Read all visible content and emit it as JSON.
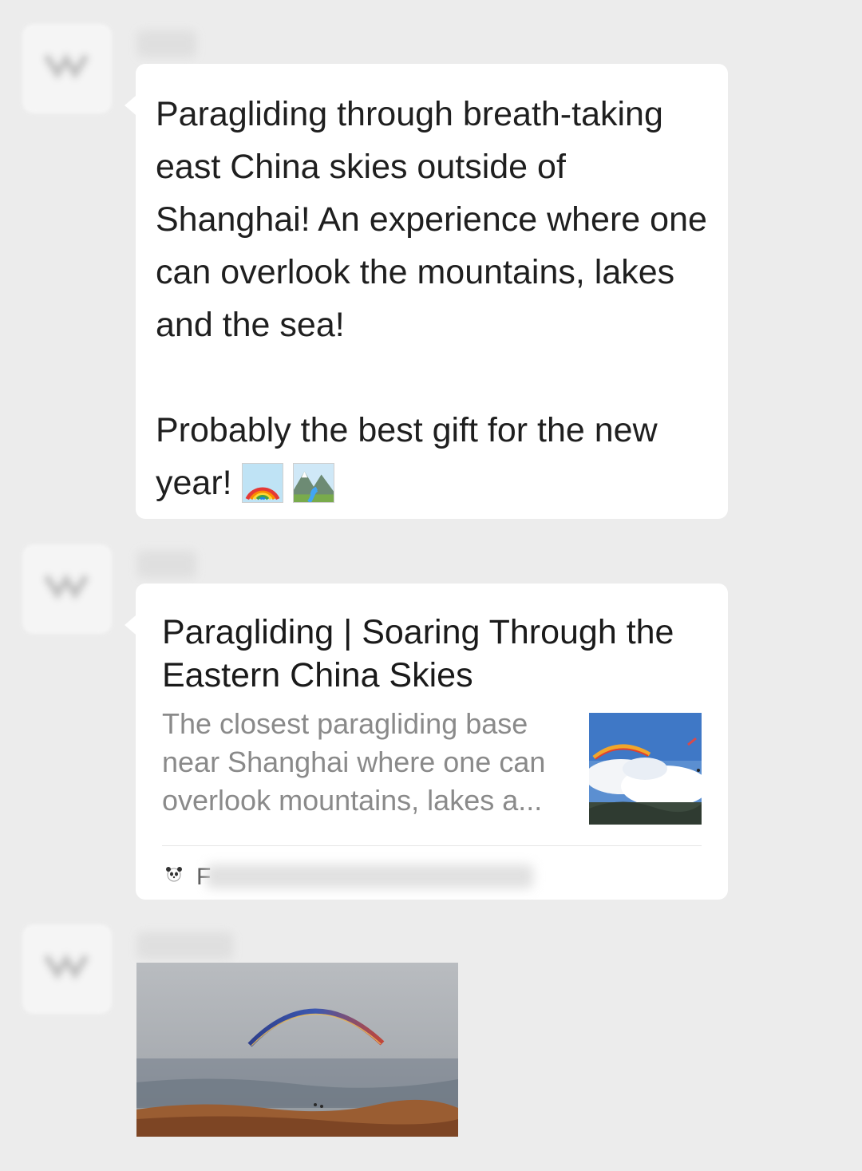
{
  "messages": [
    {
      "type": "text",
      "text": "Paragliding through breath-taking east China skies outside of Shanghai! An experience where one can overlook the mountains, lakes and the sea!\n\nProbably the best gift for the new year!",
      "emojis": [
        "rainbow-icon",
        "national-park-icon"
      ]
    },
    {
      "type": "link",
      "title": "Paragliding | Soaring Through the Eastern China Skies",
      "description": "The closest paragliding base near Shanghai where one can overlook mountains, lakes a...",
      "thumbnail": "paraglider-over-clouds-image",
      "source_visible_text": "F",
      "source_icon": "panda-icon"
    },
    {
      "type": "image",
      "image": "paraglider-wing-photo"
    }
  ],
  "colors": {
    "chat_background": "#ececec",
    "bubble_background": "#ffffff",
    "text": "#1f1f1f",
    "secondary_text": "#8a8a8a"
  }
}
